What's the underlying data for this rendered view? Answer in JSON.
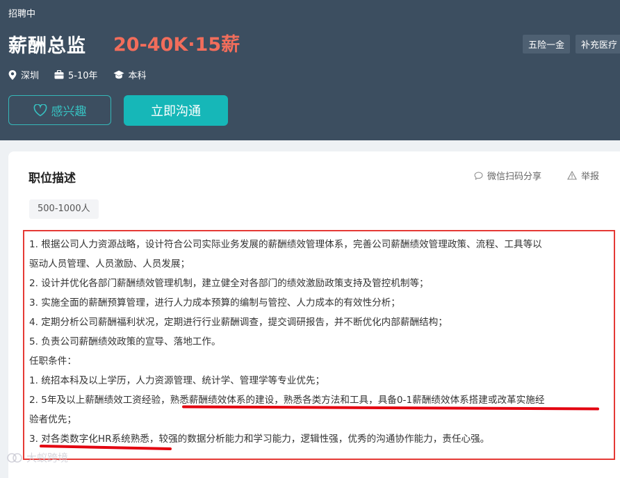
{
  "header": {
    "status": "招聘中",
    "title": "薪酬总监",
    "salary": "20-40K·15薪",
    "tags": [
      "五险一金",
      "补充医疗"
    ],
    "meta": {
      "location": "深圳",
      "experience": "5-10年",
      "education": "本科"
    },
    "interest_label": "感兴趣",
    "chat_label": "立即沟通"
  },
  "panel": {
    "section_title": "职位描述",
    "share_label": "微信扫码分享",
    "report_label": "举报",
    "company_size": "500-1000人"
  },
  "description": {
    "lines": [
      "1.  根据公司人力资源战略，设计符合公司实际业务发展的薪酬绩效管理体系，完善公司薪酬绩效管理政策、流程、工具等以",
      "驱动人员管理、人员激励、人员发展；",
      "2.  设计并优化各部门薪酬绩效管理机制，建立健全对各部门的绩效激励政策支持及管控机制等；",
      "3.  实施全面的薪酬预算管理，进行人力成本预算的编制与管控、人力成本的有效性分析；",
      "4.  定期分析公司薪酬福利状况，定期进行行业薪酬调查，提交调研报告，并不断优化内部薪酬结构；",
      "5.  负责公司薪酬绩效政策的宣导、落地工作。",
      "任职条件：",
      "1.  统招本科及以上学历，人力资源管理、统计学、管理学等专业优先；",
      "2.  5年及以上薪酬绩效工资经验，熟悉薪酬绩效体系的建设，熟悉各类方法和工具，具备0-1薪酬绩效体系搭建或改革实施经",
      "验者优先；",
      "3.  对各类数字化HR系统熟悉，较强的数据分析能力和学习能力，逻辑性强，优秀的沟通协作能力，责任心强。"
    ]
  },
  "watermark": "大蚁跨境",
  "colors": {
    "hero_bg": "#3c4e60",
    "salary": "#f26d5b",
    "accent": "#16b7b8",
    "annotation": "#e53935"
  }
}
